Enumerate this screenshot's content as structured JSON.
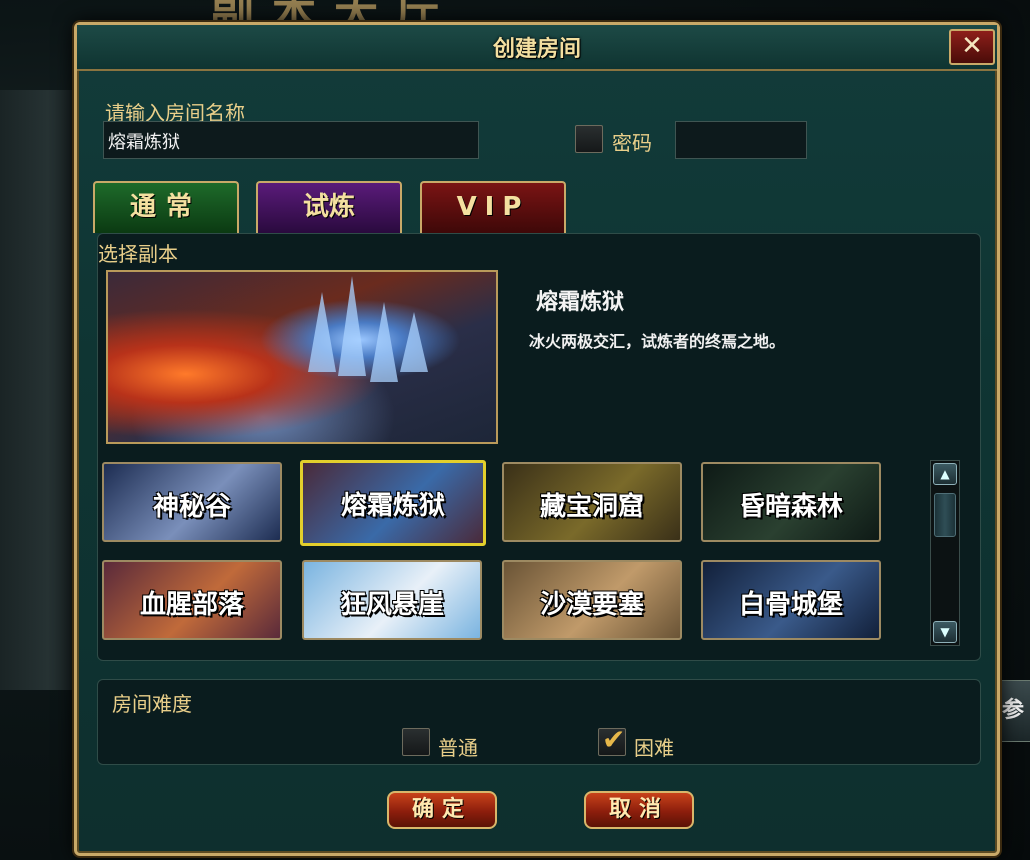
{
  "background": {
    "title": "副本大厅",
    "side_tab": "参加"
  },
  "dialog": {
    "title": "创建房间",
    "close_label": "✕",
    "room_name_label": "请输入房间名称",
    "room_name_value": "熔霜炼狱",
    "password_label": "密码",
    "password_checked": false,
    "password_value": ""
  },
  "tabs": [
    {
      "label": "通常",
      "active": false
    },
    {
      "label": "试炼",
      "active": true
    },
    {
      "label": "VIP",
      "active": false
    }
  ],
  "dungeon_panel": {
    "label": "选择副本",
    "selected_title": "熔霜炼狱",
    "selected_desc": "冰火两极交汇，试炼者的终焉之地。",
    "dungeons": [
      {
        "name": "神秘谷",
        "selected": false,
        "colors": [
          "#1d2d52",
          "#7a8fba"
        ]
      },
      {
        "name": "熔霜炼狱",
        "selected": true,
        "colors": [
          "#4a2a3a",
          "#3a6aa8"
        ]
      },
      {
        "name": "藏宝洞窟",
        "selected": false,
        "colors": [
          "#3a3018",
          "#7a6a2a"
        ]
      },
      {
        "name": "昏暗森林",
        "selected": false,
        "colors": [
          "#0e1a16",
          "#2a4030"
        ]
      },
      {
        "name": "血腥部落",
        "selected": false,
        "colors": [
          "#5a2a3a",
          "#c06a3a"
        ]
      },
      {
        "name": "狂风悬崖",
        "selected": false,
        "colors": [
          "#7ab4e0",
          "#e8f0f8"
        ]
      },
      {
        "name": "沙漠要塞",
        "selected": false,
        "colors": [
          "#6a5436",
          "#c09a6a"
        ]
      },
      {
        "name": "白骨城堡",
        "selected": false,
        "colors": [
          "#12203a",
          "#3a5a8a"
        ]
      }
    ],
    "scroll_up": "▲",
    "scroll_down": "▼"
  },
  "difficulty": {
    "label": "房间难度",
    "options": [
      {
        "label": "普通",
        "checked": false
      },
      {
        "label": "困难",
        "checked": true
      }
    ]
  },
  "buttons": {
    "confirm": "确定",
    "cancel": "取消"
  },
  "colors": {
    "accent_gold": "#c9a968",
    "panel_teal": "#0f3533",
    "selected_border": "#e3cf2c"
  }
}
